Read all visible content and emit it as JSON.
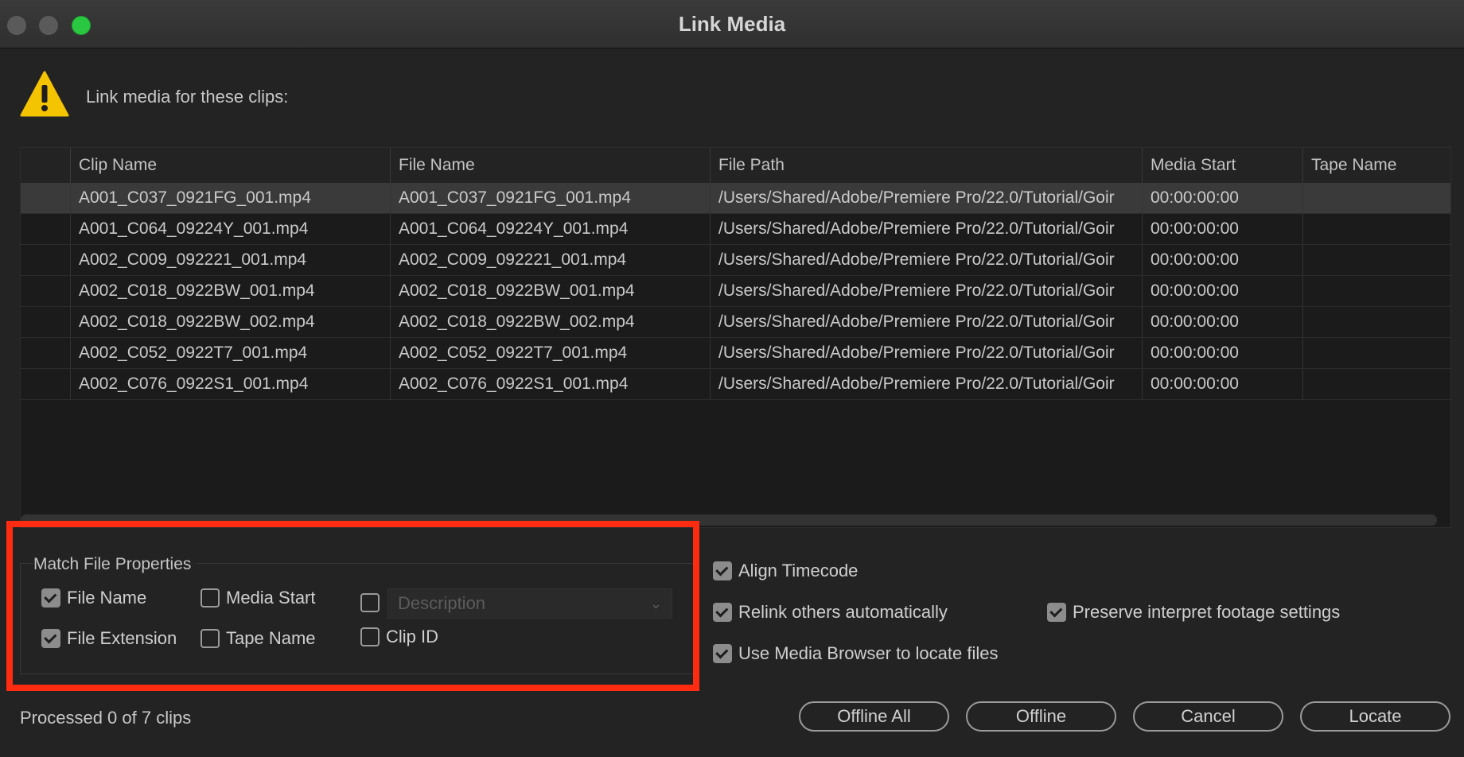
{
  "window": {
    "title": "Link Media"
  },
  "prompt": "Link media for these clips:",
  "table": {
    "columns": [
      "",
      "Clip Name",
      "File Name",
      "File Path",
      "Media Start",
      "Tape Name"
    ],
    "rows": [
      [
        "A001_C037_0921FG_001.mp4",
        "A001_C037_0921FG_001.mp4",
        "/Users/Shared/Adobe/Premiere Pro/22.0/Tutorial/Goir",
        "00:00:00:00",
        ""
      ],
      [
        "A001_C064_09224Y_001.mp4",
        "A001_C064_09224Y_001.mp4",
        "/Users/Shared/Adobe/Premiere Pro/22.0/Tutorial/Goir",
        "00:00:00:00",
        ""
      ],
      [
        "A002_C009_092221_001.mp4",
        "A002_C009_092221_001.mp4",
        "/Users/Shared/Adobe/Premiere Pro/22.0/Tutorial/Goir",
        "00:00:00:00",
        ""
      ],
      [
        "A002_C018_0922BW_001.mp4",
        "A002_C018_0922BW_001.mp4",
        "/Users/Shared/Adobe/Premiere Pro/22.0/Tutorial/Goir",
        "00:00:00:00",
        ""
      ],
      [
        "A002_C018_0922BW_002.mp4",
        "A002_C018_0922BW_002.mp4",
        "/Users/Shared/Adobe/Premiere Pro/22.0/Tutorial/Goir",
        "00:00:00:00",
        ""
      ],
      [
        "A002_C052_0922T7_001.mp4",
        "A002_C052_0922T7_001.mp4",
        "/Users/Shared/Adobe/Premiere Pro/22.0/Tutorial/Goir",
        "00:00:00:00",
        ""
      ],
      [
        "A002_C076_0922S1_001.mp4",
        "A002_C076_0922S1_001.mp4",
        "/Users/Shared/Adobe/Premiere Pro/22.0/Tutorial/Goir",
        "00:00:00:00",
        ""
      ]
    ]
  },
  "match": {
    "title": "Match File Properties",
    "file_name": {
      "label": "File Name",
      "checked": true
    },
    "media_start": {
      "label": "Media Start",
      "checked": false
    },
    "description": {
      "label": "Description",
      "checked": false
    },
    "file_extension": {
      "label": "File Extension",
      "checked": true
    },
    "tape_name": {
      "label": "Tape Name",
      "checked": false
    },
    "clip_id": {
      "label": "Clip ID",
      "checked": false
    }
  },
  "options": {
    "align_timecode": {
      "label": "Align Timecode",
      "checked": true
    },
    "relink_others": {
      "label": "Relink others automatically",
      "checked": true
    },
    "preserve_interpret": {
      "label": "Preserve interpret footage settings",
      "checked": true
    },
    "use_media_browser": {
      "label": "Use Media Browser to locate files",
      "checked": true
    }
  },
  "status": "Processed 0 of 7 clips",
  "buttons": {
    "offline_all": "Offline All",
    "offline": "Offline",
    "cancel": "Cancel",
    "locate": "Locate"
  },
  "colors": {
    "highlight": "#ff2c12",
    "warning": "#f5c400",
    "zoom_button": "#2ac840"
  }
}
